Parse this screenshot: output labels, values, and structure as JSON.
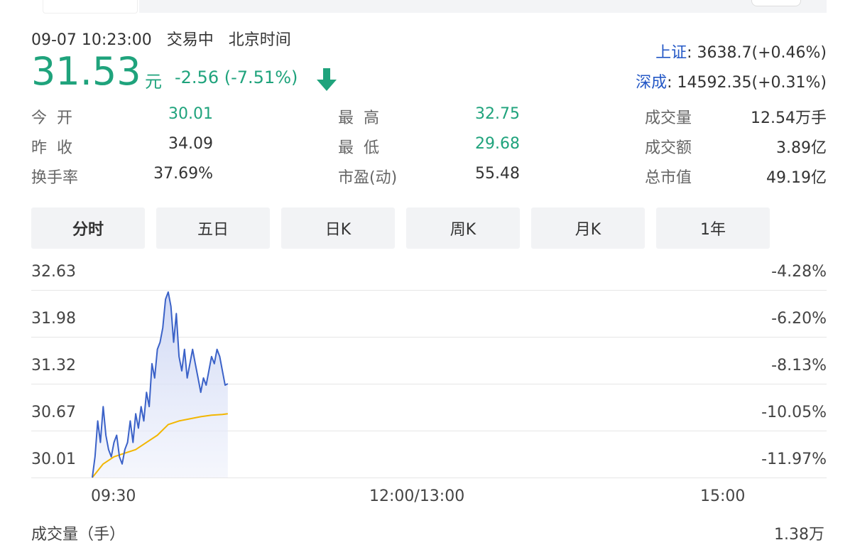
{
  "status": {
    "datetime": "09-07 10:23:00",
    "state": "交易中",
    "timezone": "北京时间"
  },
  "quote": {
    "price": "31.53",
    "unit": "元",
    "change": "-2.56 (-7.51%)"
  },
  "indices": [
    {
      "name": "上证",
      "value": "3638.7(+0.46%)"
    },
    {
      "name": "深成",
      "value": "14592.35(+0.31%)"
    }
  ],
  "stats": {
    "open": {
      "label": "今  开",
      "value": "30.01"
    },
    "prev_close": {
      "label": "昨  收",
      "value": "34.09"
    },
    "turnover_rate": {
      "label": "换手率",
      "value": "37.69%"
    },
    "high": {
      "label": "最  高",
      "value": "32.75"
    },
    "low": {
      "label": "最  低",
      "value": "29.68"
    },
    "pe": {
      "label": "市盈(动)",
      "value": "55.48"
    },
    "volume": {
      "label": "成交量",
      "value": "12.54万手"
    },
    "amount": {
      "label": "成交额",
      "value": "3.89亿"
    },
    "market_cap": {
      "label": "总市值",
      "value": "49.19亿"
    }
  },
  "tabs": [
    "分时",
    "五日",
    "日K",
    "周K",
    "月K",
    "1年"
  ],
  "active_tab": 0,
  "chart_data": {
    "type": "line",
    "y_ticks": [
      "32.63",
      "31.98",
      "31.32",
      "30.67",
      "30.01"
    ],
    "y_pct_ticks": [
      "-4.28%",
      "-6.20%",
      "-8.13%",
      "-10.05%",
      "-11.97%"
    ],
    "x_ticks": [
      "09:30",
      "12:00/13:00",
      "15:00"
    ],
    "ylim": [
      30.01,
      32.63
    ],
    "session_minutes": 240,
    "price_line_color": "#3b62c8",
    "avg_line_color": "#f2b600",
    "series": [
      {
        "values": [
          [
            0,
            30.01
          ],
          [
            1,
            30.3
          ],
          [
            2,
            30.8
          ],
          [
            3,
            30.5
          ],
          [
            4,
            31.0
          ],
          [
            5,
            30.6
          ],
          [
            6,
            30.4
          ],
          [
            7,
            30.3
          ],
          [
            8,
            30.5
          ],
          [
            9,
            30.6
          ],
          [
            10,
            30.3
          ],
          [
            11,
            30.2
          ],
          [
            12,
            30.4
          ],
          [
            13,
            30.5
          ],
          [
            14,
            30.8
          ],
          [
            15,
            30.5
          ],
          [
            16,
            30.9
          ],
          [
            17,
            30.7
          ],
          [
            18,
            31.0
          ],
          [
            19,
            30.8
          ],
          [
            20,
            31.2
          ],
          [
            21,
            31.0
          ],
          [
            22,
            31.6
          ],
          [
            23,
            31.4
          ],
          [
            24,
            31.8
          ],
          [
            25,
            31.9
          ],
          [
            26,
            32.1
          ],
          [
            27,
            32.5
          ],
          [
            28,
            32.6
          ],
          [
            29,
            32.4
          ],
          [
            30,
            31.9
          ],
          [
            31,
            32.3
          ],
          [
            32,
            31.7
          ],
          [
            33,
            31.5
          ],
          [
            34,
            31.8
          ],
          [
            35,
            31.4
          ],
          [
            36,
            31.6
          ],
          [
            37,
            31.8
          ],
          [
            38,
            31.6
          ],
          [
            39,
            31.4
          ],
          [
            40,
            31.2
          ],
          [
            41,
            31.4
          ],
          [
            42,
            31.3
          ],
          [
            43,
            31.5
          ],
          [
            44,
            31.7
          ],
          [
            45,
            31.6
          ],
          [
            46,
            31.8
          ],
          [
            47,
            31.7
          ],
          [
            48,
            31.5
          ],
          [
            49,
            31.3
          ],
          [
            50,
            31.32
          ]
        ]
      },
      {
        "values": [
          [
            0,
            30.01
          ],
          [
            4,
            30.2
          ],
          [
            8,
            30.3
          ],
          [
            12,
            30.35
          ],
          [
            16,
            30.4
          ],
          [
            20,
            30.5
          ],
          [
            24,
            30.6
          ],
          [
            28,
            30.75
          ],
          [
            32,
            30.8
          ],
          [
            36,
            30.83
          ],
          [
            40,
            30.86
          ],
          [
            44,
            30.88
          ],
          [
            48,
            30.89
          ],
          [
            50,
            30.9
          ]
        ]
      }
    ]
  },
  "volume_section": {
    "label": "成交量（手）",
    "max": "1.38万"
  }
}
